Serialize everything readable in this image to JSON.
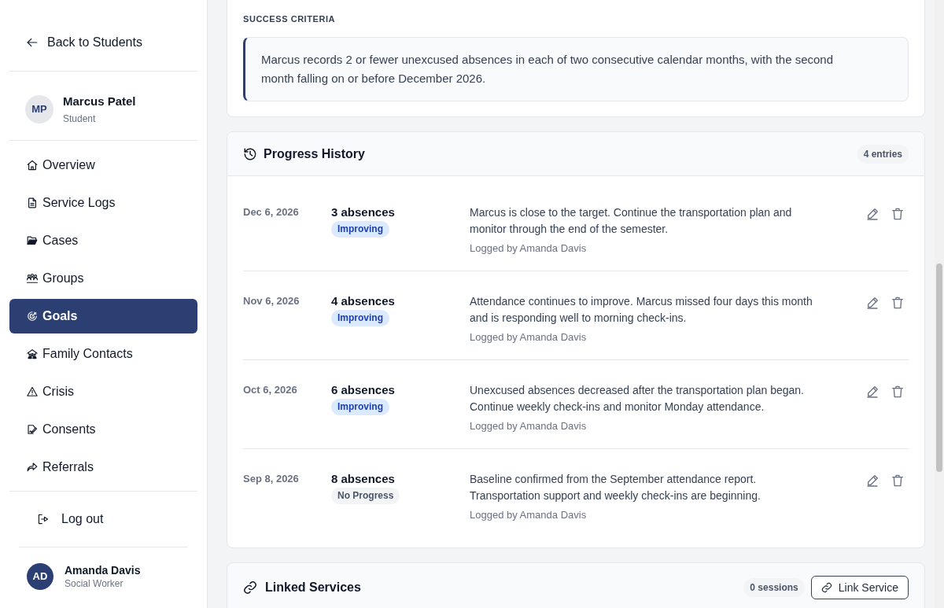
{
  "sidebar": {
    "back_link": "Back to Students",
    "student": {
      "initials": "MP",
      "name": "Marcus Patel",
      "role": "Student"
    },
    "nav_items": [
      {
        "label": "Overview",
        "selected": false
      },
      {
        "label": "Service Logs",
        "selected": false
      },
      {
        "label": "Cases",
        "selected": false
      },
      {
        "label": "Groups",
        "selected": false
      },
      {
        "label": "Goals",
        "selected": true
      },
      {
        "label": "Family Contacts",
        "selected": false
      },
      {
        "label": "Crisis",
        "selected": false
      },
      {
        "label": "Consents",
        "selected": false
      },
      {
        "label": "Referrals",
        "selected": false
      }
    ],
    "logout": "Log out",
    "user": {
      "initials": "AD",
      "name": "Amanda Davis",
      "role": "Social Worker"
    }
  },
  "success_criteria": {
    "heading": "SUCCESS CRITERIA",
    "text": "Marcus records 2 or fewer unexcused absences in each of two consecutive calendar months, with the second month falling on or before December 2026."
  },
  "progress_history": {
    "title": "Progress History",
    "count": "4 entries",
    "entries": [
      {
        "date": "Dec 6, 2026",
        "value": "3 absences",
        "status": "Improving",
        "kind": "improving",
        "note": "Marcus is close to the target. Continue the transportation plan and monitor through the end of the semester.",
        "logged_by": "Logged by Amanda Davis"
      },
      {
        "date": "Nov 6, 2026",
        "value": "4 absences",
        "status": "Improving",
        "kind": "improving",
        "note": "Attendance continues to improve. Marcus missed four days this month and is responding well to morning check-ins.",
        "logged_by": "Logged by Amanda Davis"
      },
      {
        "date": "Oct 6, 2026",
        "value": "6 absences",
        "status": "Improving",
        "kind": "improving",
        "note": "Unexcused absences decreased after the transportation plan began. Continue weekly check-ins and monitor Monday attendance.",
        "logged_by": "Logged by Amanda Davis"
      },
      {
        "date": "Sep 8, 2026",
        "value": "8 absences",
        "status": "No Progress",
        "kind": "no_progress",
        "note": "Baseline confirmed from the September attendance report. Transportation support and weekly check-ins are beginning.",
        "logged_by": "Logged by Amanda Davis"
      }
    ]
  },
  "linked_services": {
    "title": "Linked Services",
    "count": "0 sessions",
    "button": "Link Service"
  }
}
